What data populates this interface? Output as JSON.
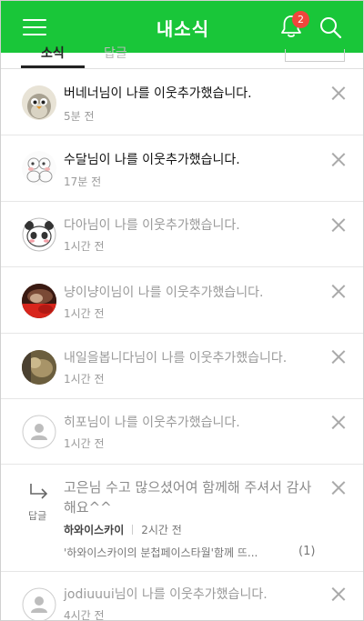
{
  "header": {
    "title": "내소식",
    "notification_count": "2",
    "colors": {
      "brand": "#19c639",
      "badge": "#f0463c"
    }
  },
  "tabs": [
    "소식",
    "답글"
  ],
  "notifications": [
    {
      "text": "버네너님이 나를 이웃추가했습니다.",
      "time": "5분 전",
      "read": false
    },
    {
      "text": "수달님이 나를 이웃추가했습니다.",
      "time": "17분 전",
      "read": false
    },
    {
      "text": "다아님이 나를 이웃추가했습니다.",
      "time": "1시간 전",
      "read": true
    },
    {
      "text": "냥이냥이님이 나를 이웃추가했습니다.",
      "time": "1시간 전",
      "read": true
    },
    {
      "text": "내일을봅니다님이 나를 이웃추가했습니다.",
      "time": "1시간 전",
      "read": true
    },
    {
      "text": "히포님이 나를 이웃추가했습니다.",
      "time": "1시간 전",
      "read": true
    }
  ],
  "reply": {
    "icon_label": "답글",
    "text": "고은님 수고 많으셨어여 함께해 주셔서 감사해요^^",
    "author": "하와이스카이",
    "time": "2시간 전",
    "quote": "'하와이스카이의 분첩페이스타월'함께 뜨...",
    "count": "(1)"
  },
  "last": {
    "text": "jodiuuui님이 나를 이웃추가했습니다.",
    "time": "4시간 전",
    "read": true
  }
}
